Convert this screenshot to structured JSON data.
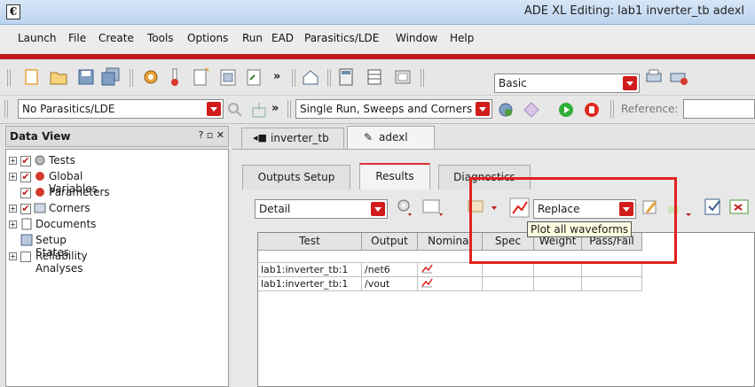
{
  "window": {
    "title": "ADE XL Editing: lab1 inverter_tb adexl",
    "app_icon": "€"
  },
  "menu": [
    "Launch",
    "File",
    "Create",
    "Tools",
    "Options",
    "Run",
    "EAD",
    "Parasitics/LDE",
    "Window",
    "Help"
  ],
  "toolbar": {
    "mode_combo": "Basic",
    "parasitics_combo": "No Parasitics/LDE",
    "run_mode_combo": "Single Run, Sweeps and Corners",
    "reference_label": "Reference:",
    "reference_value": ""
  },
  "data_view": {
    "title": "Data View",
    "controls": "? ▫ ✕",
    "items": [
      {
        "label": "Tests",
        "checked": true,
        "expandable": true
      },
      {
        "label": "Global Variables",
        "checked": true,
        "expandable": true
      },
      {
        "label": "Parameters",
        "checked": true,
        "expandable": false
      },
      {
        "label": "Corners",
        "checked": true,
        "expandable": true
      },
      {
        "label": "Documents",
        "checked": false,
        "expandable": true
      },
      {
        "label": "Setup States",
        "checked": false,
        "expandable": false
      },
      {
        "label": "Reliability Analyses",
        "checked": false,
        "expandable": true
      }
    ]
  },
  "editor_tabs": [
    "inverter_tb",
    "adexl"
  ],
  "sub_tabs": [
    "Outputs Setup",
    "Results",
    "Diagnostics"
  ],
  "results_toolbar": {
    "view_combo": "Detail",
    "plot_mode_combo": "Replace"
  },
  "table": {
    "columns": [
      "Test",
      "Output",
      "Nominal",
      "Spec",
      "Weight",
      "Pass/Fail"
    ],
    "rows": [
      {
        "test": "lab1:inverter_tb:1",
        "output": "/net6"
      },
      {
        "test": "lab1:inverter_tb:1",
        "output": "/vout"
      }
    ]
  },
  "tooltip": "Plot all waveforms",
  "colors": {
    "accent_red": "#c21a1a",
    "highlight": "#e0221e"
  }
}
